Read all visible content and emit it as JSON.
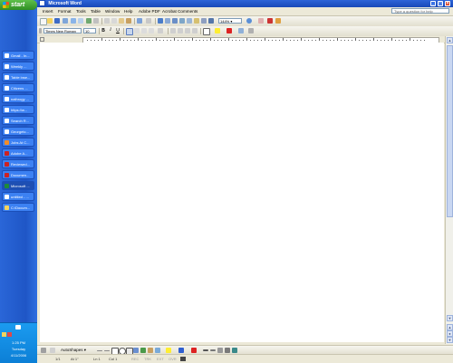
{
  "taskbar": {
    "start_label": "start",
    "tasks": [
      {
        "label": "Gmail - In...",
        "icon": "mail-icon",
        "color": "#ffffff"
      },
      {
        "label": "Weekly ...",
        "icon": "browser-icon",
        "color": "#ffffff"
      },
      {
        "label": "Table inse...",
        "icon": "browser-icon",
        "color": "#ffffff"
      },
      {
        "label": "Citizens ...",
        "icon": "browser-icon",
        "color": "#ffffff"
      },
      {
        "label": "nathrogy ...",
        "icon": "browser-icon",
        "color": "#ffffff"
      },
      {
        "label": "https://w...",
        "icon": "browser-icon",
        "color": "#ffffff"
      },
      {
        "label": "Search R...",
        "icon": "browser-icon",
        "color": "#ffffff"
      },
      {
        "label": "Georgetc...",
        "icon": "browser-icon",
        "color": "#ffffff"
      },
      {
        "label": "Jobs At C...",
        "icon": "firefox-icon",
        "color": "#f28c28"
      },
      {
        "label": "Adobe A...",
        "icon": "adobe-icon",
        "color": "#cc2222"
      },
      {
        "label": "Reviewed...",
        "icon": "adobe-icon",
        "color": "#cc2222"
      },
      {
        "label": "Documen...",
        "icon": "adobe-icon",
        "color": "#cc2222"
      },
      {
        "label": "Microsoft ...",
        "icon": "excel-icon",
        "color": "#1e8a3a"
      },
      {
        "label": "untitled - ...",
        "icon": "paint-icon",
        "color": "#ffffff"
      },
      {
        "label": "C:\\Docum...",
        "icon": "folder-icon",
        "color": "#f4d35e"
      }
    ],
    "tray": {
      "time": "1:25 PM",
      "day": "Tuesday",
      "date": "4/11/2006"
    }
  },
  "window": {
    "title": "Microsoft Word",
    "menus": [
      "Insert",
      "Format",
      "Tools",
      "Table",
      "Window",
      "Help",
      "Adobe PDF",
      "Acrobat Comments"
    ],
    "help_placeholder": "Type a question for help",
    "zoom": "144%",
    "font_name": "Times New Roman",
    "font_size": "10",
    "bold": "B",
    "italic": "I",
    "underline": "U"
  },
  "drawing_toolbar": {
    "autoshapes_label": "AutoShapes ▾"
  },
  "status_bar": {
    "page": "1/1",
    "at": "At 1\"",
    "line": "Ln 1",
    "col": "Col 1",
    "rec": "REC",
    "trk": "TRK",
    "ext": "EXT",
    "ovr": "OVR"
  }
}
